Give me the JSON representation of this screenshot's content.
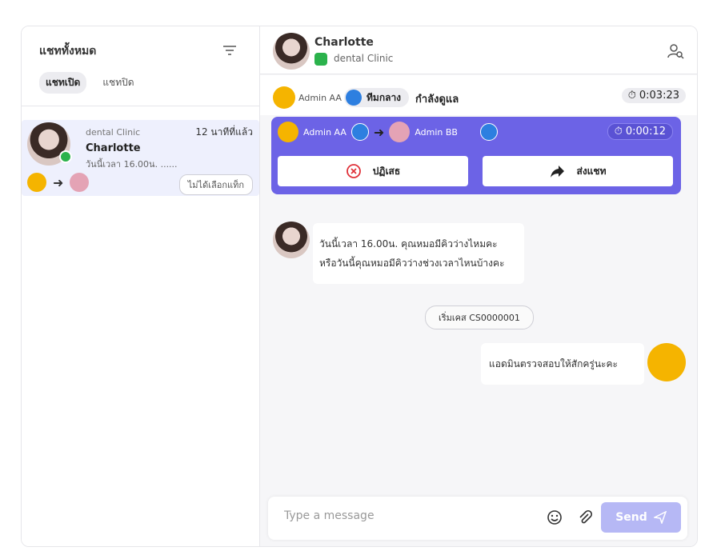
{
  "sidebar": {
    "title": "แชททั้งหมด",
    "tabs": [
      "แชทเปิด",
      "แชทปิด"
    ],
    "chat": {
      "clinic": "dental Clinic",
      "time": "12 นาทีที่แล้ว",
      "name": "Charlotte",
      "preview": "วันนี้เวลา 16.00น. ......",
      "tag_button": "ไม่ได้เลือกแท็ก"
    }
  },
  "header": {
    "name": "Charlotte",
    "clinic": "dental Clinic"
  },
  "status": {
    "admin": "Admin AA",
    "team": "ทีมกลาง",
    "state": "กำลังดูแล",
    "timer": "0:03:23"
  },
  "transfer": {
    "from": "Admin AA",
    "to": "Admin BB",
    "timer": "0:00:12",
    "reject_label": "ปฏิเสธ",
    "send_label": "ส่งแชท"
  },
  "messages": {
    "incoming_line1": "วันนี้เวลา 16.00น. คุณหมอมีคิวว่างไหมคะ",
    "incoming_line2": "หรือวันนี้คุณหมอมีคิวว่างช่วงเวลาไหนบ้างคะ",
    "case_pill": "เริ่มเคส CS0000001",
    "outgoing": "แอดมินตรวจสอบให้สักครู่นะคะ"
  },
  "composer": {
    "placeholder": "Type a message",
    "send_label": "Send"
  },
  "colors": {
    "accent": "#6c63e6",
    "send_disabled": "#b6b8f5",
    "line_green": "#2bb24c",
    "team_blue": "#2d7fe0",
    "admin_yellow": "#f5b400"
  }
}
